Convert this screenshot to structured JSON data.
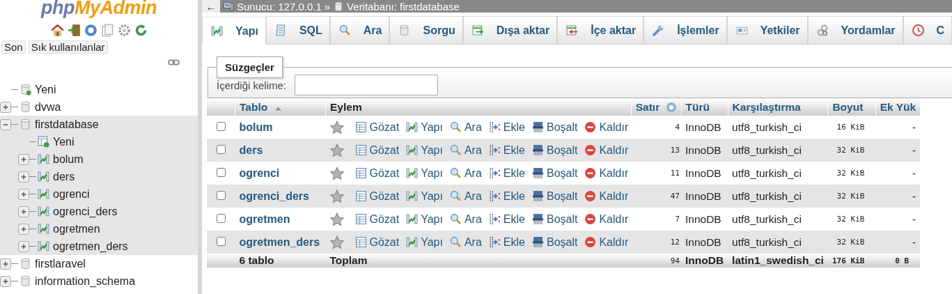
{
  "sidebar": {
    "logo": [
      "php",
      "MyAdmin"
    ],
    "buttons": [
      "Son",
      "Sık kullanılanlar"
    ],
    "tree": [
      {
        "label": "Yeni",
        "kind": "new"
      },
      {
        "label": "dvwa",
        "kind": "database",
        "expanded": false
      },
      {
        "label": "firstdatabase",
        "kind": "database",
        "expanded": true,
        "children": [
          {
            "label": "Yeni",
            "kind": "new-table"
          },
          {
            "label": "bolum",
            "kind": "table",
            "expanded": false
          },
          {
            "label": "ders",
            "kind": "table",
            "expanded": false
          },
          {
            "label": "ogrenci",
            "kind": "table",
            "expanded": false
          },
          {
            "label": "ogrenci_ders",
            "kind": "table",
            "expanded": false
          },
          {
            "label": "ogretmen",
            "kind": "table",
            "expanded": false
          },
          {
            "label": "ogretmen_ders",
            "kind": "table",
            "expanded": false
          }
        ]
      },
      {
        "label": "firstlaravel",
        "kind": "database",
        "expanded": false
      },
      {
        "label": "information_schema",
        "kind": "database",
        "expanded": false
      }
    ]
  },
  "breadcrumb": {
    "back": "←",
    "server": "Sunucu: 127.0.0.1",
    "separator": "»",
    "database": "Veritabanı: firstdatabase"
  },
  "tabs": [
    {
      "label": "Yapı",
      "selected": true
    },
    {
      "label": "SQL",
      "selected": false
    },
    {
      "label": "Ara",
      "selected": false
    },
    {
      "label": "Sorgu",
      "selected": false
    },
    {
      "label": "Dışa aktar",
      "selected": false
    },
    {
      "label": "İçe aktar",
      "selected": false
    },
    {
      "label": "İşlemler",
      "selected": false
    },
    {
      "label": "Yetkiler",
      "selected": false
    },
    {
      "label": "Yordamlar",
      "selected": false
    },
    {
      "label": "C",
      "selected": false
    }
  ],
  "filter": {
    "legend": "Süzgeçler",
    "label": "İçerdiği kelime:"
  },
  "table": {
    "columns": [
      "Tablo",
      "Eylem",
      "Satır",
      "Türü",
      "Karşılaştırma",
      "Boyut",
      "Ek Yük"
    ],
    "rows": [
      {
        "checked": false,
        "name": "bolum",
        "actions": [
          "Gözat",
          "Yapı",
          "Ara",
          "Ekle",
          "Boşalt",
          "Kaldır"
        ],
        "rows": "4",
        "engine": "InnoDB",
        "collation": "utf8_turkish_ci",
        "size": "16 KiB",
        "overhead": "-"
      },
      {
        "checked": false,
        "name": "ders",
        "actions": [
          "Gözat",
          "Yapı",
          "Ara",
          "Ekle",
          "Boşalt",
          "Kaldır"
        ],
        "rows": "13",
        "engine": "InnoDB",
        "collation": "utf8_turkish_ci",
        "size": "32 KiB",
        "overhead": "-"
      },
      {
        "checked": false,
        "name": "ogrenci",
        "actions": [
          "Gözat",
          "Yapı",
          "Ara",
          "Ekle",
          "Boşalt",
          "Kaldır"
        ],
        "rows": "11",
        "engine": "InnoDB",
        "collation": "utf8_turkish_ci",
        "size": "32 KiB",
        "overhead": "-"
      },
      {
        "checked": false,
        "name": "ogrenci_ders",
        "actions": [
          "Gözat",
          "Yapı",
          "Ara",
          "Ekle",
          "Boşalt",
          "Kaldır"
        ],
        "rows": "47",
        "engine": "InnoDB",
        "collation": "utf8_turkish_ci",
        "size": "32 KiB",
        "overhead": "-"
      },
      {
        "checked": false,
        "name": "ogretmen",
        "actions": [
          "Gözat",
          "Yapı",
          "Ara",
          "Ekle",
          "Boşalt",
          "Kaldır"
        ],
        "rows": "7",
        "engine": "InnoDB",
        "collation": "utf8_turkish_ci",
        "size": "32 KiB",
        "overhead": "-"
      },
      {
        "checked": false,
        "name": "ogretmen_ders",
        "actions": [
          "Gözat",
          "Yapı",
          "Ara",
          "Ekle",
          "Boşalt",
          "Kaldır"
        ],
        "rows": "12",
        "engine": "InnoDB",
        "collation": "utf8_turkish_ci",
        "size": "32 KiB",
        "overhead": "-"
      }
    ],
    "footer": {
      "count": "6 tablo",
      "label": "Toplam",
      "rows": "94",
      "engine": "InnoDB",
      "collation": "latin1_swedish_ci",
      "size": "176 KiB",
      "overhead": "0 B"
    }
  }
}
